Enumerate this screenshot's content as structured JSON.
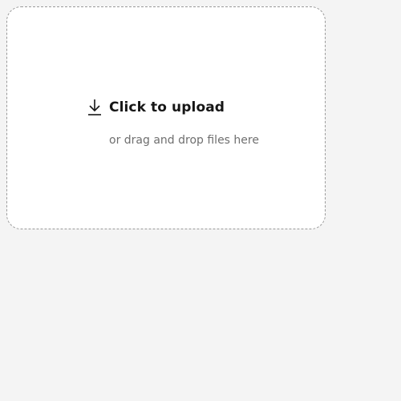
{
  "upload": {
    "title": "Click to upload",
    "subtitle": "or drag and drop files here",
    "icon": "download-icon"
  }
}
